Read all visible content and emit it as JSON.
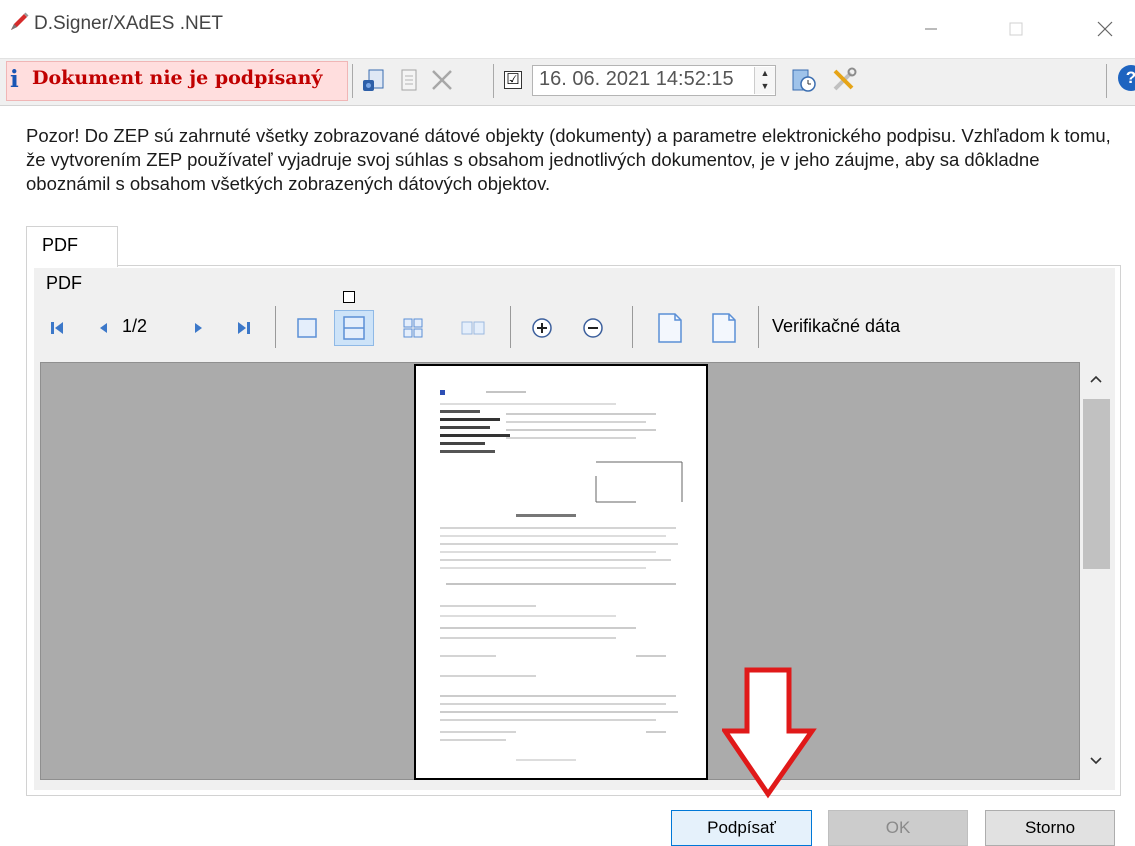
{
  "window": {
    "title": "D.Signer/XAdES .NET"
  },
  "toolbar": {
    "status_icon": "i",
    "status_text": "Dokument nie je podpísaný",
    "date_checked": "☑",
    "datetime_value": "16. 06. 2021 14:52:15",
    "help_icon_glyph": "?"
  },
  "notice": {
    "text": "Pozor! Do ZEP sú zahrnuté všetky zobrazované dátové objekty (dokumenty) a parametre elektronického podpisu. Vzhľadom k tomu, že vytvorením ZEP používateľ vyjadruje svoj súhlas s obsahom jednotlivých dokumentov, je v jeho záujme, aby sa dôkladne oboznámil s obsahom všetkých zobrazených dátových objektov."
  },
  "tabs": [
    {
      "label": "PDF"
    }
  ],
  "viewer": {
    "title": "PDF",
    "page_indicator": "1/2",
    "verification_label": "Verifikačné dáta"
  },
  "buttons": {
    "sign": "Podpísať",
    "ok": "OK",
    "storno": "Storno"
  },
  "colors": {
    "status_bg": "#ffdede",
    "status_text": "#c00000",
    "arrow": "#e01919",
    "primary_button_border": "#0078d7"
  }
}
